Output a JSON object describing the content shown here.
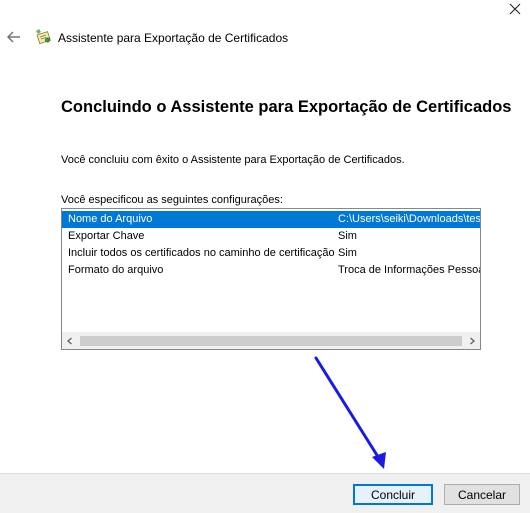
{
  "header": {
    "title": "Assistente para Exportação de Certificados"
  },
  "main": {
    "page_title": "Concluindo o Assistente para Exportação de Certificados",
    "completion_text": "Você concluiu com êxito o Assistente para Exportação de Certificados.",
    "settings_caption": "Você especificou as seguintes configurações:",
    "settings": [
      {
        "name": "Nome do Arquivo",
        "value": "C:\\Users\\seiki\\Downloads\\tes"
      },
      {
        "name": "Exportar Chave",
        "value": "Sim"
      },
      {
        "name": "Incluir todos os certificados no caminho de certificação",
        "value": "Sim"
      },
      {
        "name": "Formato do arquivo",
        "value": "Troca de Informações Pessoa"
      }
    ]
  },
  "footer": {
    "finish_label": "Concluir",
    "cancel_label": "Cancelar"
  },
  "icons": {
    "close": "close-icon",
    "back": "back-arrow-icon",
    "wizard": "certificate-wizard-icon",
    "annotation": "blue-arrow-annotation"
  },
  "colors": {
    "selection": "#0078d7",
    "annotation": "#1a1ae6",
    "footer_bg": "#f0f0f0"
  }
}
